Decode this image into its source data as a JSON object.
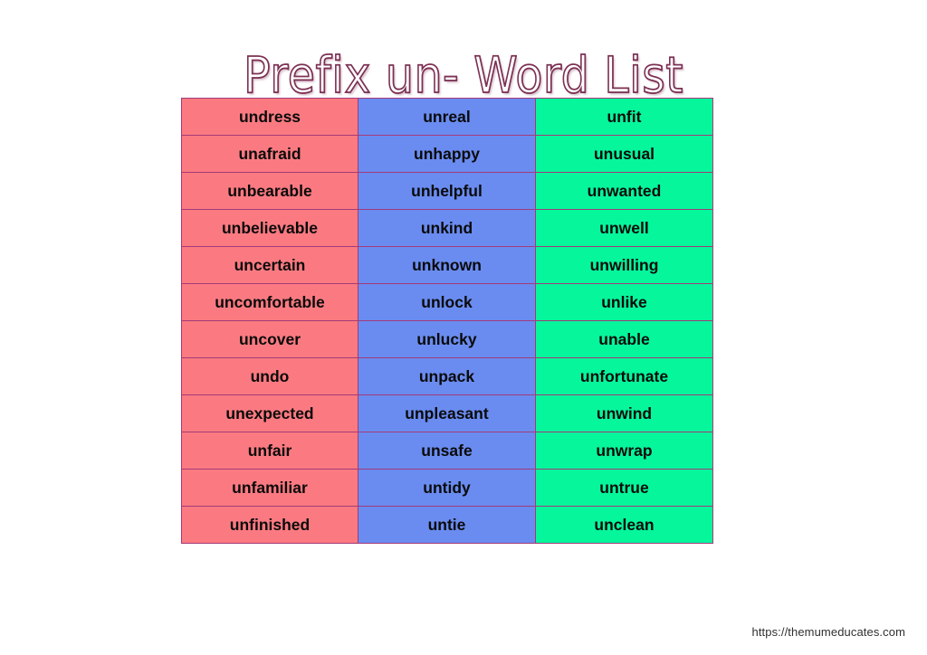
{
  "title": "Prefix un- Word List",
  "footer": {
    "url": "https://themumeducates.com"
  },
  "colors": {
    "column_red": "#fb7a81",
    "column_blue": "#6a8cf0",
    "column_green": "#06f69c",
    "border": "#a33a79",
    "title_outline": "#7c3053",
    "title_fill": "#ffffff",
    "cell_text": "#0a0a0a",
    "background": "#ffffff"
  },
  "table": {
    "columns": 3,
    "rows_count": 12,
    "column_styles": [
      "col-red",
      "col-blue",
      "col-green"
    ],
    "rows": [
      [
        "undress",
        "unreal",
        "unfit"
      ],
      [
        "unafraid",
        "unhappy",
        "unusual"
      ],
      [
        "unbearable",
        "unhelpful",
        "unwanted"
      ],
      [
        "unbelievable",
        "unkind",
        "unwell"
      ],
      [
        "uncertain",
        "unknown",
        "unwilling"
      ],
      [
        "uncomfortable",
        "unlock",
        "unlike"
      ],
      [
        "uncover",
        "unlucky",
        "unable"
      ],
      [
        "undo",
        "unpack",
        "unfortunate"
      ],
      [
        "unexpected",
        "unpleasant",
        "unwind"
      ],
      [
        "unfair",
        "unsafe",
        "unwrap"
      ],
      [
        "unfamiliar",
        "untidy",
        "untrue"
      ],
      [
        "unfinished",
        "untie",
        "unclean"
      ]
    ]
  }
}
